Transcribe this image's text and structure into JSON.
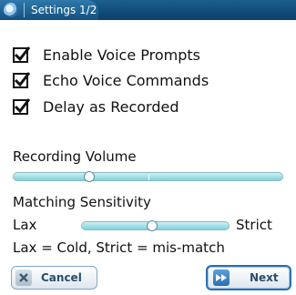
{
  "titlebar": {
    "title": "Settings 1/2",
    "icon": "app-globe-icon"
  },
  "options": [
    {
      "label": "Enable Voice Prompts",
      "checked": true
    },
    {
      "label": "Echo Voice Commands",
      "checked": true
    },
    {
      "label": "Delay as Recorded",
      "checked": true
    }
  ],
  "recording_volume": {
    "label": "Recording Volume",
    "value": 0.28
  },
  "matching_sensitivity": {
    "label": "Matching Sensitivity",
    "min_label": "Lax",
    "max_label": "Strict",
    "value": 0.48
  },
  "note": "Lax = Cold, Strict = mis-match",
  "buttons": {
    "cancel": "Cancel",
    "next": "Next"
  },
  "colors": {
    "titlebar": "#0b3f6a",
    "slider_track": "#7fd1da",
    "button_text": "#2a4d6d"
  }
}
